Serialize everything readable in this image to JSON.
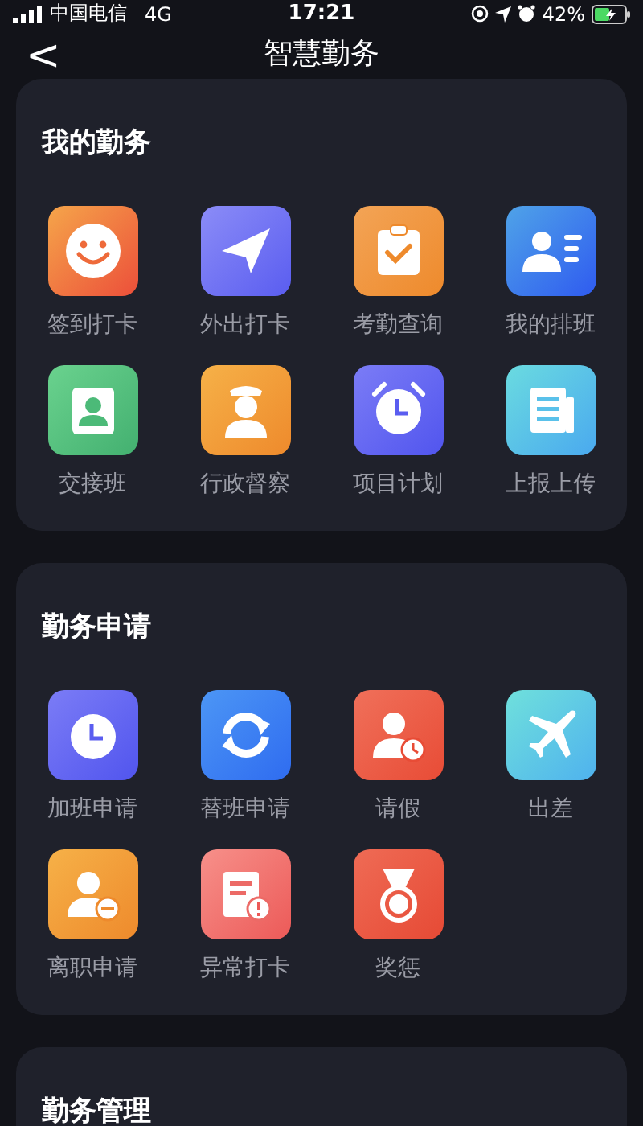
{
  "status_bar": {
    "carrier": "中国电信",
    "network": "4G",
    "time": "17:21",
    "battery": "42%"
  },
  "nav": {
    "back": "<",
    "title": "智慧勤务"
  },
  "sections": [
    {
      "title": "我的勤务",
      "items": [
        {
          "label": "签到打卡",
          "kind": "smile"
        },
        {
          "label": "外出打卡",
          "kind": "plane-paper"
        },
        {
          "label": "考勤查询",
          "kind": "clipboard"
        },
        {
          "label": "我的排班",
          "kind": "contact"
        },
        {
          "label": "交接班",
          "kind": "badge"
        },
        {
          "label": "行政督察",
          "kind": "officer"
        },
        {
          "label": "项目计划",
          "kind": "alarm"
        },
        {
          "label": "上报上传",
          "kind": "news"
        }
      ]
    },
    {
      "title": "勤务申请",
      "items": [
        {
          "label": "加班申请",
          "kind": "clock"
        },
        {
          "label": "替班申请",
          "kind": "refresh"
        },
        {
          "label": "请假",
          "kind": "person-clock"
        },
        {
          "label": "出差",
          "kind": "airplane"
        },
        {
          "label": "离职申请",
          "kind": "person-minus"
        },
        {
          "label": "异常打卡",
          "kind": "doc-alert"
        },
        {
          "label": "奖惩",
          "kind": "medal"
        }
      ]
    },
    {
      "title": "勤务管理"
    }
  ]
}
